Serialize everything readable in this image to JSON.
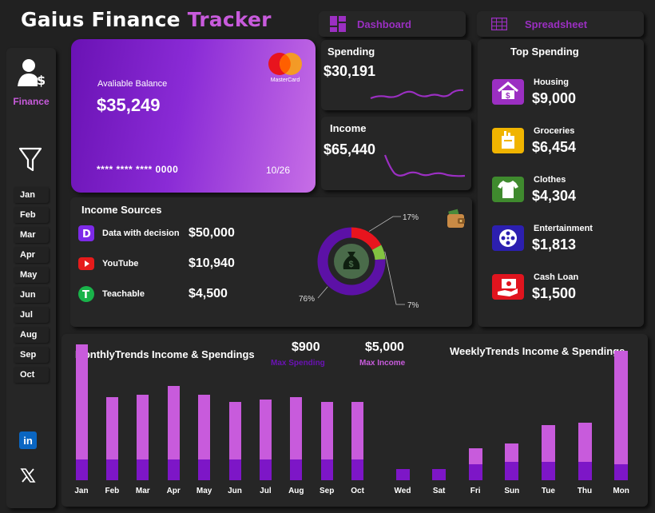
{
  "app": {
    "title_part1": "Gaius Finance",
    "title_part2": "Tracker"
  },
  "nav": {
    "dashboard_label": "Dashboard",
    "spreadsheet_label": "Spreadsheet"
  },
  "sidebar": {
    "section_label": "Finance",
    "months": [
      "Jan",
      "Feb",
      "Mar",
      "Apr",
      "May",
      "Jun",
      "Jul",
      "Aug",
      "Sep",
      "Oct"
    ]
  },
  "card": {
    "balance_label": "Avaliable Balance",
    "balance": "$35,249",
    "brand": "MasterCard",
    "number": "**** **** **** 0000",
    "expiry": "10/26"
  },
  "spending": {
    "label": "Spending",
    "value": "$30,191"
  },
  "income": {
    "label": "Income",
    "value": "$65,440"
  },
  "top_spending": {
    "title": "Top Spending",
    "items": [
      {
        "name": "Housing",
        "value": "$9,000",
        "icon": "house-dollar-icon",
        "color": "#9b2fc2"
      },
      {
        "name": "Groceries",
        "value": "$6,454",
        "icon": "grocery-bag-icon",
        "color": "#f0b400"
      },
      {
        "name": "Clothes",
        "value": "$4,304",
        "icon": "shirt-icon",
        "color": "#3f8a2e"
      },
      {
        "name": "Entertainment",
        "value": "$1,813",
        "icon": "film-reel-icon",
        "color": "#2c1fb0"
      },
      {
        "name": "Cash Loan",
        "value": "$1,500",
        "icon": "cash-hand-icon",
        "color": "#e0141e"
      }
    ]
  },
  "income_sources": {
    "title": "Income Sources",
    "items": [
      {
        "name": "Data with decision",
        "value": "$50,000",
        "icon": "d-logo-icon",
        "color": "#7d2ae8"
      },
      {
        "name": "YouTube",
        "value": "$10,940",
        "icon": "youtube-icon",
        "color": "#e61b1b"
      },
      {
        "name": "Teachable",
        "value": "$4,500",
        "icon": "teachable-icon",
        "color": "#19b34a"
      }
    ]
  },
  "donut": {
    "labels": [
      "76%",
      "17%",
      "7%"
    ],
    "values": [
      76,
      17,
      7
    ],
    "colors": [
      "#5c11a6",
      "#e8141e",
      "#82c341"
    ]
  },
  "trends": {
    "max_spending": "$900",
    "max_spending_label": "Max Spending",
    "max_income": "$5,000",
    "max_income_label": "Max Income"
  },
  "chart_data": [
    {
      "type": "bar",
      "title": "MonthlyTrends Income & Spendings",
      "categories": [
        "Jan",
        "Feb",
        "Mar",
        "Apr",
        "May",
        "Jun",
        "Jul",
        "Aug",
        "Sep",
        "Oct"
      ],
      "series": [
        {
          "values": [
            5000,
            2700,
            2800,
            3200,
            2800,
            2500,
            2600,
            2700,
            2500,
            2500
          ]
        },
        {
          "values": [
            900,
            900,
            900,
            900,
            900,
            900,
            900,
            900,
            900,
            900
          ]
        }
      ],
      "ylim": [
        0,
        5200
      ],
      "colors": [
        "#c85bdc",
        "#7d16c7"
      ]
    },
    {
      "type": "bar",
      "title": "WeeklyTrends Income & Spendings",
      "categories": [
        "Wed",
        "Sat",
        "Fri",
        "Sun",
        "Tue",
        "Thu",
        "Mon"
      ],
      "series": [
        {
          "values": [
            0,
            0,
            700,
            800,
            1600,
            1700,
            4900
          ]
        },
        {
          "values": [
            500,
            500,
            700,
            800,
            800,
            800,
            700
          ]
        }
      ],
      "ylim": [
        0,
        5200
      ],
      "colors": [
        "#c85bdc",
        "#7d16c7"
      ]
    }
  ],
  "colors": {
    "accent": "#c85bdc",
    "brand_purple": "#9b2fc2",
    "panel": "#262626",
    "background": "#212121"
  }
}
